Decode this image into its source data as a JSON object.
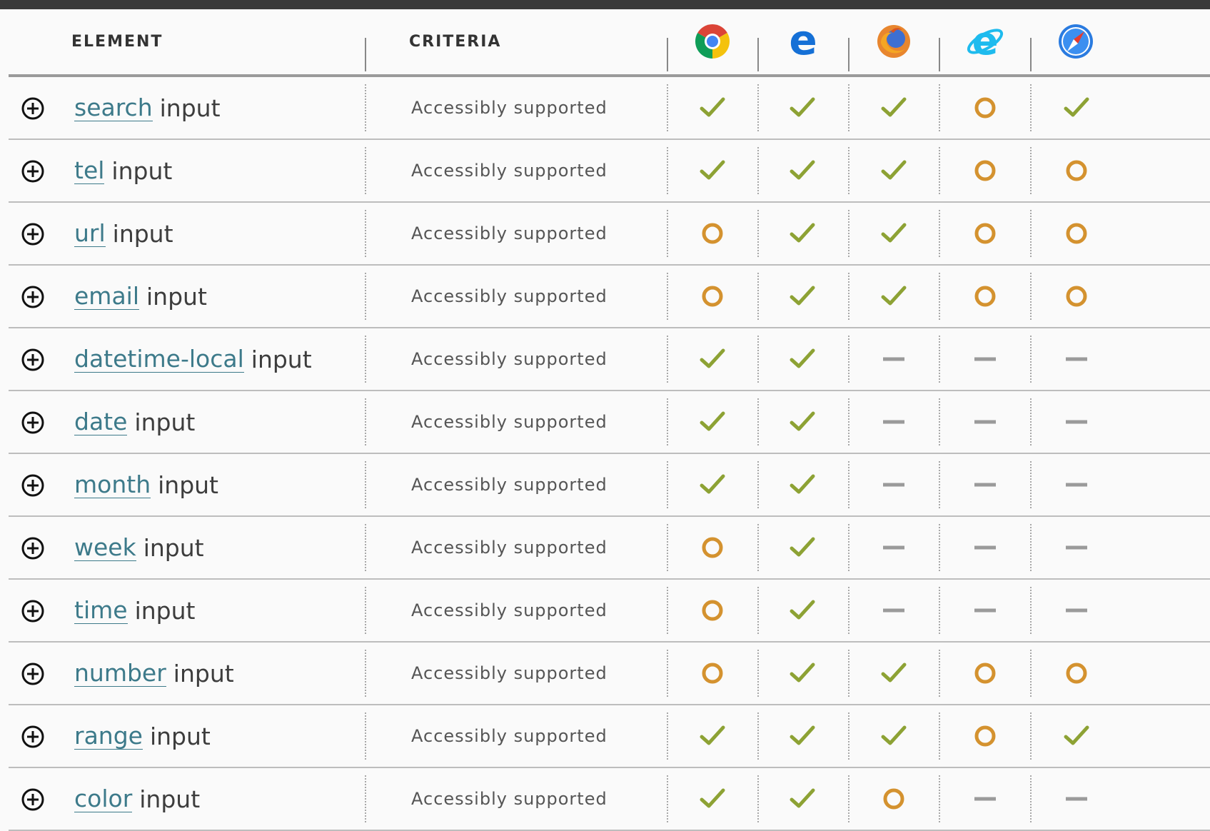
{
  "header": {
    "element_label": "ELEMENT",
    "criteria_label": "CRITERIA",
    "browsers": [
      "chrome-icon",
      "edge-icon",
      "firefox-icon",
      "internet-explorer-icon",
      "safari-icon"
    ]
  },
  "status_colors": {
    "yes": "#8da234",
    "partial": "#d4922f",
    "none": "#9a9a9a",
    "link": "#3d7a8a"
  },
  "rows": [
    {
      "name": "search",
      "suffix": "input",
      "criteria": "Accessibly supported",
      "support": [
        "yes",
        "yes",
        "yes",
        "partial",
        "yes"
      ]
    },
    {
      "name": "tel",
      "suffix": "input",
      "criteria": "Accessibly supported",
      "support": [
        "yes",
        "yes",
        "yes",
        "partial",
        "partial"
      ]
    },
    {
      "name": "url",
      "suffix": "input",
      "criteria": "Accessibly supported",
      "support": [
        "partial",
        "yes",
        "yes",
        "partial",
        "partial"
      ]
    },
    {
      "name": "email",
      "suffix": "input",
      "criteria": "Accessibly supported",
      "support": [
        "partial",
        "yes",
        "yes",
        "partial",
        "partial"
      ]
    },
    {
      "name": "datetime-local",
      "suffix": "input",
      "criteria": "Accessibly supported",
      "support": [
        "yes",
        "yes",
        "none",
        "none",
        "none"
      ]
    },
    {
      "name": "date",
      "suffix": "input",
      "criteria": "Accessibly supported",
      "support": [
        "yes",
        "yes",
        "none",
        "none",
        "none"
      ]
    },
    {
      "name": "month",
      "suffix": "input",
      "criteria": "Accessibly supported",
      "support": [
        "yes",
        "yes",
        "none",
        "none",
        "none"
      ]
    },
    {
      "name": "week",
      "suffix": "input",
      "criteria": "Accessibly supported",
      "support": [
        "partial",
        "yes",
        "none",
        "none",
        "none"
      ]
    },
    {
      "name": "time",
      "suffix": "input",
      "criteria": "Accessibly supported",
      "support": [
        "partial",
        "yes",
        "none",
        "none",
        "none"
      ]
    },
    {
      "name": "number",
      "suffix": "input",
      "criteria": "Accessibly supported",
      "support": [
        "partial",
        "yes",
        "yes",
        "partial",
        "partial"
      ]
    },
    {
      "name": "range",
      "suffix": "input",
      "criteria": "Accessibly supported",
      "support": [
        "yes",
        "yes",
        "yes",
        "partial",
        "yes"
      ]
    },
    {
      "name": "color",
      "suffix": "input",
      "criteria": "Accessibly supported",
      "support": [
        "yes",
        "yes",
        "partial",
        "none",
        "none"
      ]
    }
  ]
}
